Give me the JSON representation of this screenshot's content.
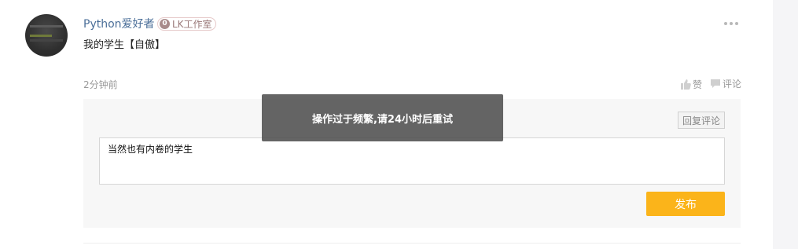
{
  "comment": {
    "username": "Python爱好者",
    "badge": {
      "level": "0",
      "label": "LK工作室"
    },
    "text": "我的学生【自傲】",
    "time": "2分钟前",
    "actions": {
      "like_label": "赞",
      "reply_label": "评论"
    },
    "icons": {
      "more": "more-dots-icon",
      "like": "thumbs-up-icon",
      "reply": "comment-bubble-icon"
    }
  },
  "reply_box": {
    "reply_comment_label": "回复评论",
    "input_value": "当然也有内卷的学生",
    "publish_label": "发布"
  },
  "toast": {
    "message": "操作过于频繁,请24小时后重试"
  },
  "colors": {
    "username": "#4a6e98",
    "publish": "#fbb41a",
    "toast_bg": "#505050"
  }
}
